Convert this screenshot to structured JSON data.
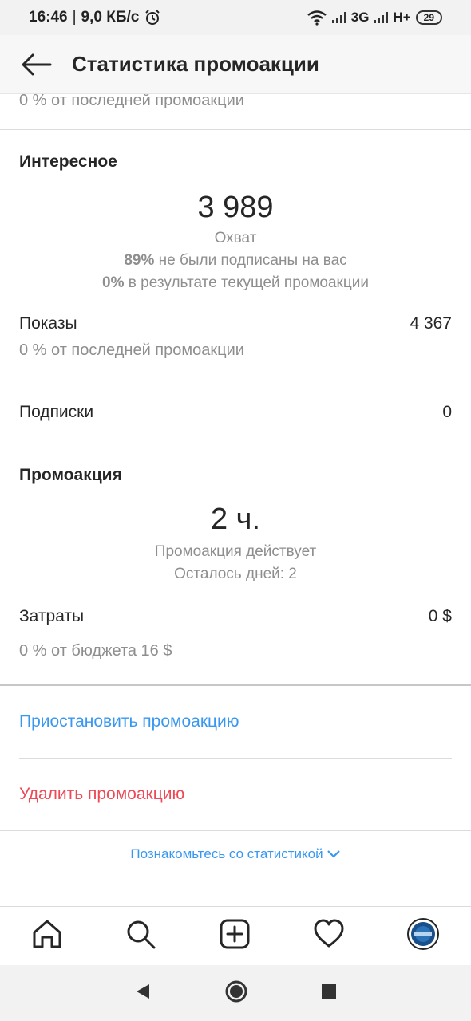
{
  "status": {
    "time": "16:46",
    "net_speed": "9,0 КБ/с",
    "net_3g": "3G",
    "net_hplus": "H+",
    "battery": "29"
  },
  "header": {
    "title": "Статистика промоакции"
  },
  "top": {
    "partial": "0 % от последней промоакции"
  },
  "interesting": {
    "title": "Интересное",
    "reach_value": "3 989",
    "reach_label": "Охват",
    "pct1": "89%",
    "pct1_text": "не были подписаны на вас",
    "pct2": "0%",
    "pct2_text": "в результате текущей промоакции",
    "impressions_label": "Показы",
    "impressions_value": "4 367",
    "impressions_sub": "0 % от последней промоакции",
    "follows_label": "Подписки",
    "follows_value": "0"
  },
  "promo": {
    "title": "Промоакция",
    "duration_value": "2 ч.",
    "duration_label": "Промоакция действует",
    "days_left": "Осталось дней: 2",
    "spend_label": "Затраты",
    "spend_value": "0 $",
    "spend_sub": "0 % от бюджета 16 $"
  },
  "actions": {
    "pause": "Приостановить промоакцию",
    "delete": "Удалить промоакцию",
    "learn_more": "Познакомьтесь со статистикой"
  },
  "icons": {
    "back": "back-arrow-icon",
    "home": "home-icon",
    "search": "search-icon",
    "add": "add-post-icon",
    "activity": "heart-icon",
    "profile": "avatar",
    "nav_back": "nav-back-icon",
    "nav_home": "nav-home-icon",
    "nav_recent": "nav-recent-icon"
  },
  "colors": {
    "link_blue": "#3897f0",
    "danger_red": "#ed4956"
  }
}
